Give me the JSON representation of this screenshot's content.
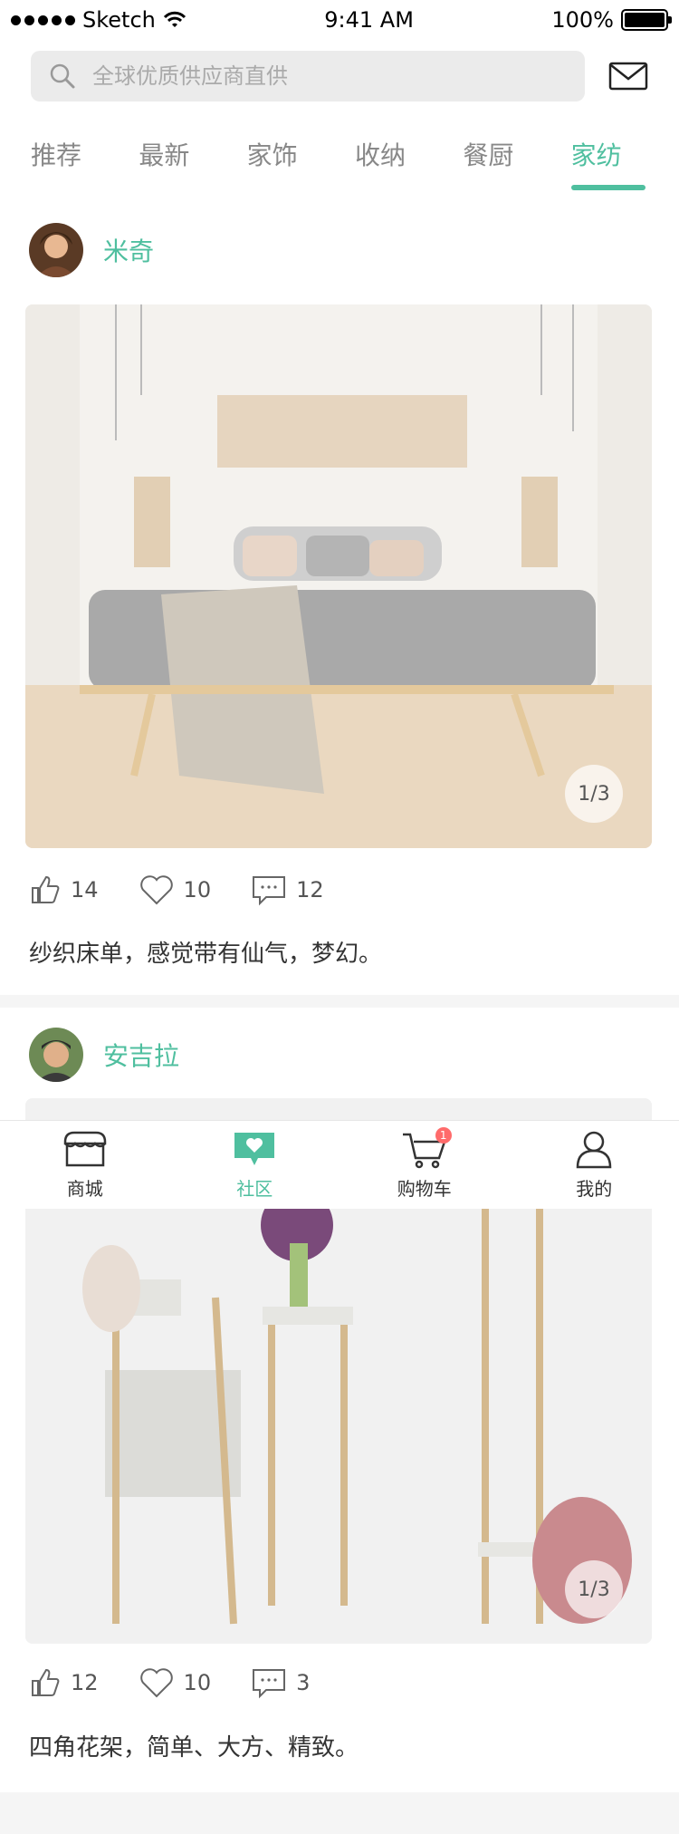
{
  "status_bar": {
    "carrier": "Sketch",
    "time": "9:41 AM",
    "battery": "100%",
    "battery_level": 1.0
  },
  "search": {
    "placeholder": "全球优质供应商直供"
  },
  "tabs": [
    {
      "label": "推荐"
    },
    {
      "label": "最新"
    },
    {
      "label": "家饰"
    },
    {
      "label": "收纳"
    },
    {
      "label": "餐厨"
    },
    {
      "label": "家纺"
    }
  ],
  "posts": [
    {
      "author": "米奇",
      "page": "1/3",
      "likes": "14",
      "favorites": "10",
      "comments": "12",
      "caption": "纱织床单，感觉带有仙气，梦幻。"
    },
    {
      "author": "安吉拉",
      "page": "1/3",
      "likes": "12",
      "favorites": "10",
      "comments": "3",
      "caption": "四角花架，简单、大方、精致。"
    }
  ],
  "tabbar": {
    "items": [
      {
        "label": "商城",
        "icon": "shop-icon"
      },
      {
        "label": "社区",
        "icon": "community-icon"
      },
      {
        "label": "购物车",
        "icon": "cart-icon",
        "badge": "1"
      },
      {
        "label": "我的",
        "icon": "profile-icon"
      }
    ]
  },
  "colors": {
    "accent": "#4fbf9f",
    "badge": "#ff6b6b"
  }
}
